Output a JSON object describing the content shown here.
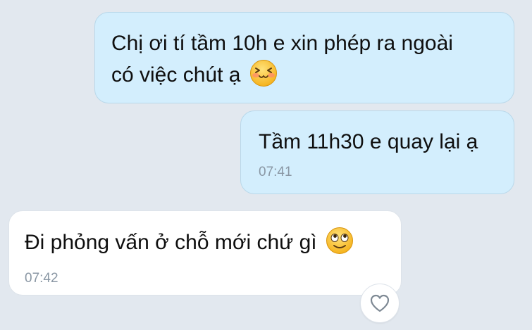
{
  "messages": [
    {
      "direction": "outgoing",
      "lines": [
        "Chị ơi tí tầm 10h e xin phép ra ngoài",
        "có việc chút ạ"
      ],
      "emoji": "blushing-squint-emoji",
      "time": ""
    },
    {
      "direction": "outgoing",
      "text": "Tầm 11h30 e quay lại ạ",
      "time": "07:41"
    },
    {
      "direction": "incoming",
      "text": "Đi phỏng vấn ở chỗ mới chứ gì",
      "emoji": "eyes-up-smile-emoji",
      "time": "07:42"
    }
  ],
  "reaction": {
    "icon": "heart-outline-icon"
  },
  "colors": {
    "background": "#e2e8ef",
    "outgoing_bubble": "#d3eefd",
    "incoming_bubble": "#ffffff",
    "timestamp": "#8a97a4"
  }
}
